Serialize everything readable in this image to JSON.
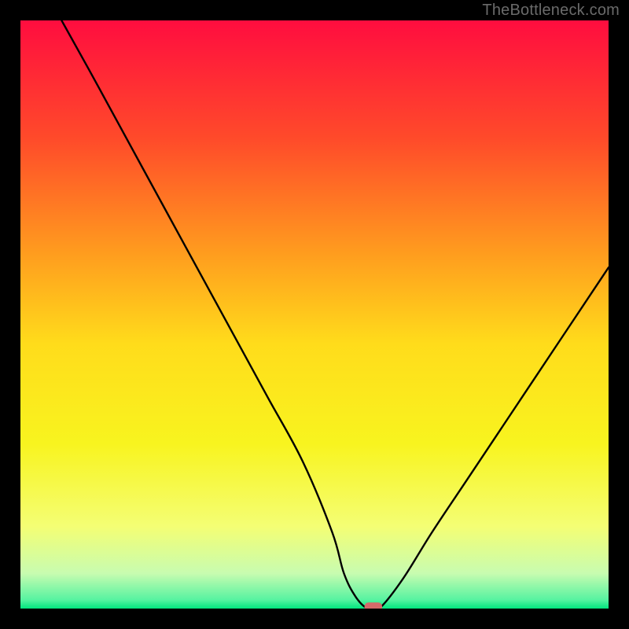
{
  "watermark": {
    "text": "TheBottleneck.com"
  },
  "chart_data": {
    "type": "line",
    "title": "",
    "xlabel": "",
    "ylabel": "",
    "xlim": [
      0,
      100
    ],
    "ylim": [
      0,
      100
    ],
    "x": [
      7,
      12,
      18,
      24,
      30,
      36,
      42,
      48,
      53,
      55,
      57,
      59,
      61,
      65,
      70,
      76,
      82,
      88,
      94,
      100
    ],
    "values": [
      100,
      91,
      80,
      69,
      58,
      47,
      36,
      25,
      13,
      6,
      2,
      0,
      0,
      5,
      13,
      22,
      31,
      40,
      49,
      58
    ],
    "marker": {
      "x_range": [
        58.5,
        61.5
      ],
      "y": 0.3
    },
    "background_gradient_stops": [
      {
        "pos": 0.0,
        "color": "#ff0d3f"
      },
      {
        "pos": 0.2,
        "color": "#ff4a2a"
      },
      {
        "pos": 0.4,
        "color": "#ff9e1e"
      },
      {
        "pos": 0.55,
        "color": "#ffdc1b"
      },
      {
        "pos": 0.72,
        "color": "#f8f41f"
      },
      {
        "pos": 0.86,
        "color": "#f4fe74"
      },
      {
        "pos": 0.94,
        "color": "#c8fcb0"
      },
      {
        "pos": 0.985,
        "color": "#57f3a1"
      },
      {
        "pos": 1.0,
        "color": "#00e57e"
      }
    ]
  }
}
